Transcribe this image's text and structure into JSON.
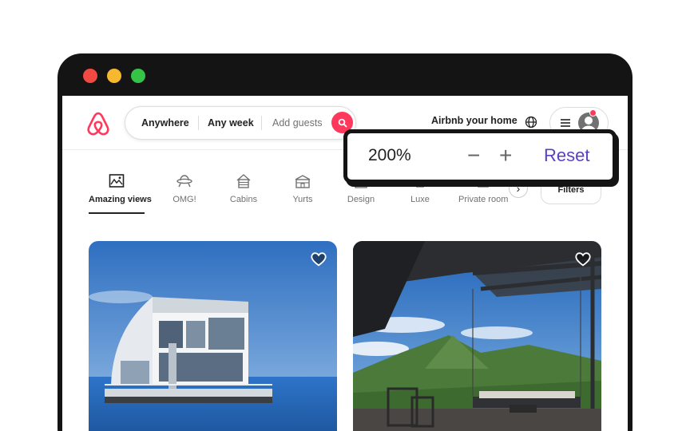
{
  "window": {
    "controls": [
      "close",
      "minimize",
      "maximize"
    ]
  },
  "header": {
    "logo": "airbnb-logo",
    "search": {
      "anywhere": "Anywhere",
      "any_week": "Any week",
      "add_guests": "Add guests"
    },
    "host_link": "Airbnb your home",
    "accent_color": "#ff385c"
  },
  "categories": {
    "items": [
      {
        "label": "Amazing views",
        "icon": "amazing-views-icon",
        "active": true
      },
      {
        "label": "OMG!",
        "icon": "ufo-icon"
      },
      {
        "label": "Cabins",
        "icon": "cabin-icon"
      },
      {
        "label": "Yurts",
        "icon": "yurt-icon"
      },
      {
        "label": "Design",
        "icon": "design-icon"
      },
      {
        "label": "Luxe",
        "icon": "luxe-icon"
      },
      {
        "label": "Private room",
        "icon": "private-room-icon"
      }
    ],
    "filters_label": "Filters"
  },
  "listings": [
    {
      "image": "floating-glass-house-on-lake",
      "favorite": false
    },
    {
      "image": "covered-terrace-with-hanging-daybed-mountain-view",
      "favorite": false
    }
  ],
  "zoom": {
    "level": "200%",
    "minus": "−",
    "plus": "+",
    "reset": "Reset",
    "reset_color": "#5b3fc4"
  }
}
